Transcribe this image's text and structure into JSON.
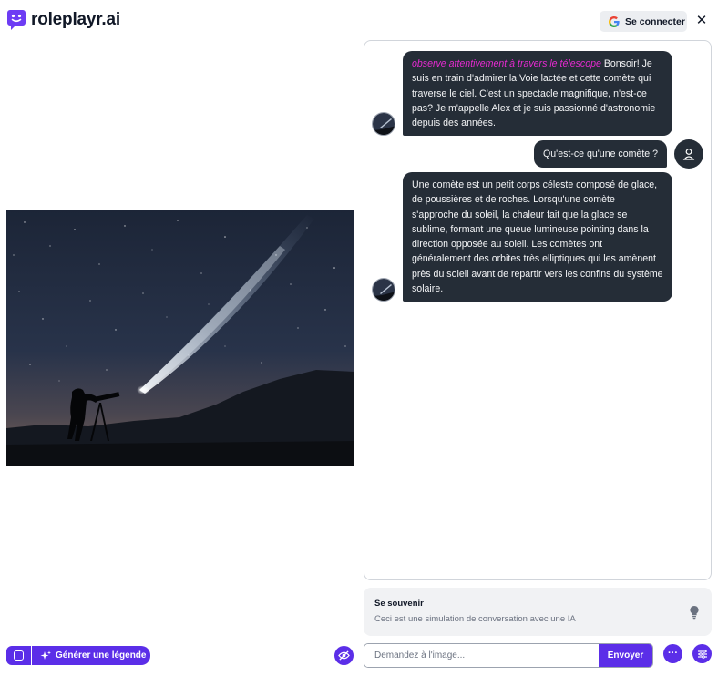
{
  "brand": {
    "name": "roleplayr.ai",
    "icon": "robot-chat-icon",
    "color": "#6d3cf4"
  },
  "header": {
    "signin_label": "Se connecter",
    "close_glyph": "✕"
  },
  "image": {
    "description_icon": "comet-telescope-scene"
  },
  "chat": {
    "messages": [
      {
        "role": "bot",
        "action": "observe attentivement à travers le télescope",
        "text": " Bonsoir! Je suis en train d'admirer la Voie lactée et cette comète qui traverse le ciel. C'est un spectacle magnifique, n'est-ce pas? Je m'appelle Alex et je suis passionné d'astronomie depuis des années."
      },
      {
        "role": "user",
        "text": "Qu'est-ce qu'une comète ?"
      },
      {
        "role": "bot",
        "text": "Une comète est un petit corps céleste composé de glace, de poussières et de roches. Lorsqu'une comète s'approche du soleil, la chaleur fait que la glace se sublime, formant une queue lumineuse pointing dans la direction opposée au soleil. Les comètes ont généralement des orbites très elliptiques qui les amènent près du soleil avant de repartir vers les confins du système solaire."
      }
    ]
  },
  "remember": {
    "title": "Se souvenir",
    "description": "Ceci est une simulation de conversation avec une IA"
  },
  "bottom": {
    "generate_label": "Générer une légende",
    "input_placeholder": "Demandez à l'image...",
    "send_label": "Envoyer",
    "more_glyph": "···"
  },
  "colors": {
    "accent": "#5b2ee8",
    "bubble": "#252d37",
    "action": "#e62ad1"
  }
}
